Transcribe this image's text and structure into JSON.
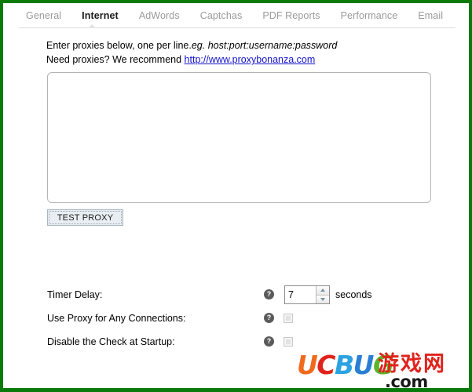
{
  "window": {
    "border_color": "#0a7a0a"
  },
  "tabs": {
    "items": [
      {
        "label": "General",
        "active": false
      },
      {
        "label": "Internet",
        "active": true
      },
      {
        "label": "AdWords",
        "active": false
      },
      {
        "label": "Captchas",
        "active": false
      },
      {
        "label": "PDF Reports",
        "active": false
      },
      {
        "label": "Performance",
        "active": false
      },
      {
        "label": "Email",
        "active": false
      }
    ]
  },
  "internet_panel": {
    "instruction_line1_plain": "Enter proxies below, one per line.",
    "instruction_line1_emphasis": "eg. host:port:username:password",
    "instruction_line2_prefix": "Need proxies? We recommend ",
    "proxy_link_text": "http://www.proxybonanza.com",
    "proxy_textarea_value": "",
    "proxy_textarea_placeholder": "",
    "test_proxy_label": "TEST PROXY",
    "help_icon_glyph": "?"
  },
  "settings": {
    "timer_delay": {
      "label": "Timer Delay:",
      "value": "7",
      "unit": "seconds"
    },
    "use_proxy_any_connections": {
      "label": "Use Proxy for Any Connections:",
      "checked": false
    },
    "disable_check_at_startup": {
      "label": "Disable the Check at Startup:",
      "checked": false
    }
  },
  "watermark": {
    "letters": [
      "U",
      "C",
      "B",
      "U",
      "G"
    ],
    "chinese_text": "游戏网",
    "domain_suffix": ".com",
    "colors": {
      "u1": "#f06a1e",
      "c": "#e0231c",
      "b": "#2aa3e0",
      "u2": "#2a7fd4",
      "g": "#5bb52b",
      "chinese": "#e0231c",
      "domain": "#1a1a1a"
    }
  }
}
